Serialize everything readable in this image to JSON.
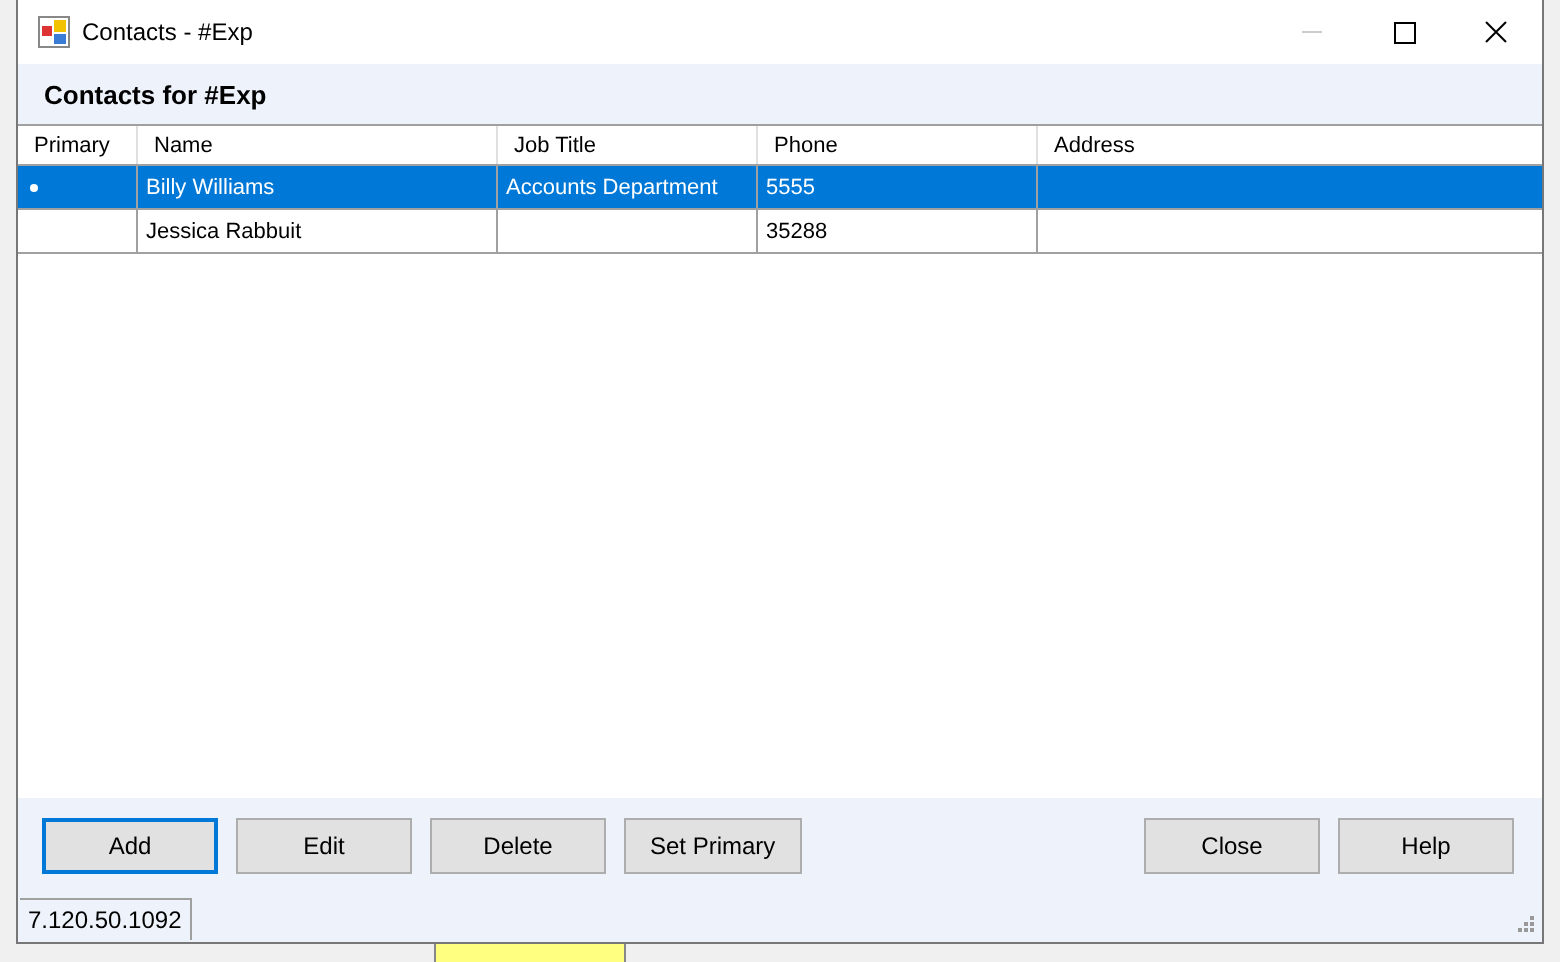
{
  "window": {
    "title": "Contacts - #Exp",
    "minimize_disabled": true
  },
  "header": "Contacts for #Exp",
  "table": {
    "columns": [
      "Primary",
      "Name",
      "Job Title",
      "Phone",
      "Address"
    ],
    "rows": [
      {
        "primary": true,
        "name": "Billy Williams",
        "job_title": "Accounts Department",
        "phone": "5555",
        "selected": true
      },
      {
        "primary": false,
        "name": "Jessica Rabbuit",
        "job_title": "",
        "phone": "35288",
        "selected": false
      }
    ]
  },
  "buttons_left": [
    {
      "label": "Add",
      "focused": true
    },
    {
      "label": "Edit",
      "focused": false
    },
    {
      "label": "Delete",
      "focused": false
    },
    {
      "label": "Set Primary",
      "focused": false
    }
  ],
  "buttons_right": [
    {
      "label": "Close",
      "focused": false
    },
    {
      "label": "Help",
      "focused": false
    }
  ],
  "status_bar": "7.120.50.1092"
}
